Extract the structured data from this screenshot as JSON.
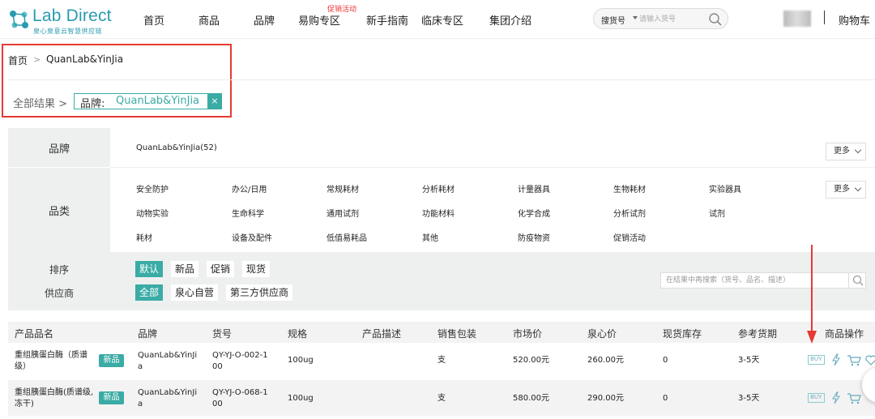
{
  "header": {
    "logo_text": "Lab Direct",
    "logo_sub": "泉心泉意云智慧供应链",
    "nav": [
      "首页",
      "商品",
      "品牌",
      "易购专区",
      "新手指南",
      "临床专区",
      "集团介绍"
    ],
    "nav_promo": "促销活动",
    "search_type": "搜货号",
    "search_placeholder": "请输入货号",
    "cart": "购物车"
  },
  "breadcrumb": {
    "home": "首页",
    "sep": ">",
    "current": "QuanLab&YinJia",
    "all_results": "全部结果 >",
    "filter_key": "品牌:",
    "filter_value": "QuanLab&YinJia",
    "filter_remove": "×"
  },
  "filters": {
    "brand_label": "品牌",
    "brand_value": "QuanLab&YinJia(52)",
    "more": "更多",
    "category_label": "品类",
    "categories": [
      "安全防护",
      "办公/日用",
      "常规耗材",
      "分析耗材",
      "计量器具",
      "生物耗材",
      "实验器具",
      "动物实验",
      "生命科学",
      "通用试剂",
      "功能材料",
      "化学合成",
      "分析试剂",
      "试剂",
      "耗材",
      "设备及配件",
      "低值易耗品",
      "其他",
      "防疫物资",
      "促销活动"
    ],
    "sort_label": "排序",
    "sort_options": [
      "默认",
      "新品",
      "促销",
      "现货"
    ],
    "supplier_label": "供应商",
    "supplier_options": [
      "全部",
      "泉心自营",
      "第三方供应商"
    ],
    "refine_placeholder": "在结果中再搜索（货号、品名、描述）"
  },
  "table": {
    "headers": [
      "产品品名",
      "品牌",
      "货号",
      "规格",
      "产品描述",
      "销售包装",
      "市场价",
      "泉心价",
      "现货库存",
      "参考货期",
      "商品操作"
    ],
    "rows": [
      {
        "name_line1": "重组胰蛋白酶（质谱",
        "name_line2": "级）",
        "badge": "新品",
        "brand_line1": "QuanLab&YinJi",
        "brand_line2": "a",
        "sku_line1": "QY-YJ-O-002-1",
        "sku_line2": "00",
        "spec": "100ug",
        "desc": "",
        "pack": "支",
        "market_price": "520.00元",
        "our_price": "260.00元",
        "stock": "0",
        "lead_time": "3-5天",
        "buy": "BUY"
      },
      {
        "name_line1": "重组胰蛋白酶(质谱级,",
        "name_line2": "冻干)",
        "badge": "新品",
        "brand_line1": "QuanLab&YinJi",
        "brand_line2": "a",
        "sku_line1": "QY-YJ-O-068-1",
        "sku_line2": "00",
        "spec": "100ug",
        "desc": "",
        "pack": "支",
        "market_price": "580.00元",
        "our_price": "290.00元",
        "stock": "0",
        "lead_time": "3-5天",
        "buy": "BUY"
      }
    ]
  },
  "colors": {
    "accent": "#3aaba5",
    "highlight_box": "#e53935",
    "promo": "#e33333"
  }
}
